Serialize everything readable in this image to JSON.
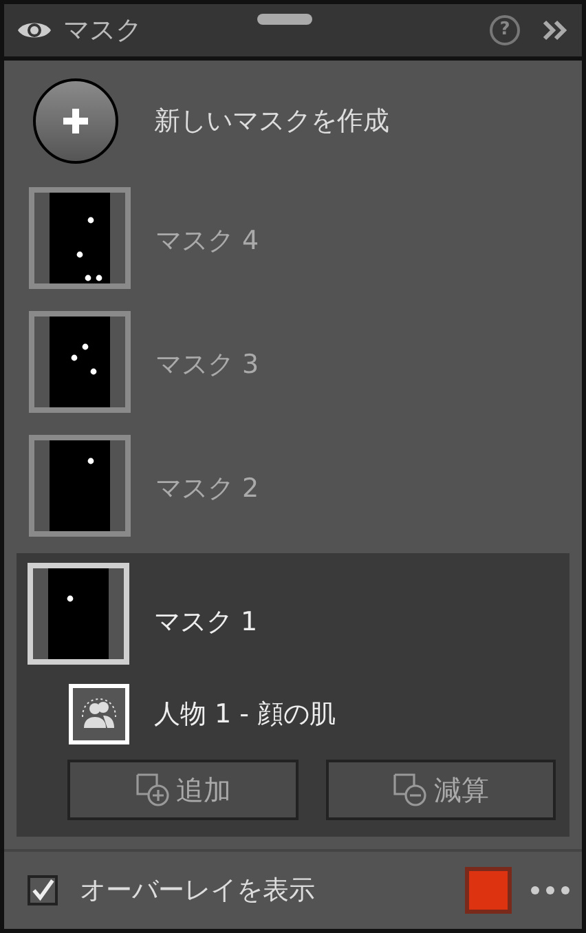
{
  "header": {
    "title": "マスク",
    "help": "?"
  },
  "create": {
    "label": "新しいマスクを作成"
  },
  "masks": [
    {
      "name": "マスク 4",
      "selected": false
    },
    {
      "name": "マスク 3",
      "selected": false
    },
    {
      "name": "マスク 2",
      "selected": false
    },
    {
      "name": "マスク 1",
      "selected": true,
      "components": [
        {
          "label": "人物 1 - 顔の肌"
        }
      ],
      "buttons": [
        {
          "kind": "add",
          "label": "追加"
        },
        {
          "kind": "subtract",
          "label": "減算"
        }
      ]
    }
  ],
  "overlay": {
    "label": "オーバーレイを表示",
    "checked": true,
    "color": "#dd3311"
  }
}
